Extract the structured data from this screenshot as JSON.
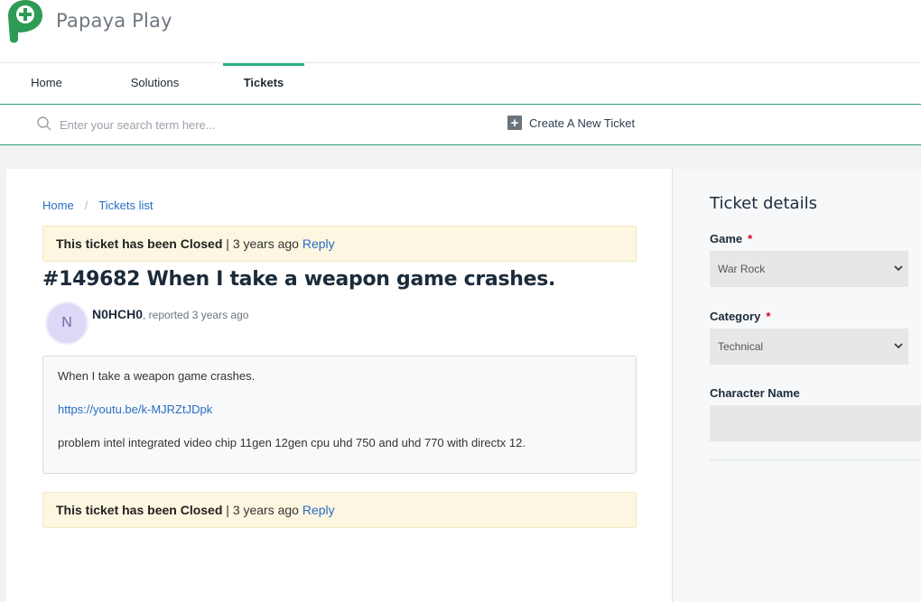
{
  "brand": {
    "name": "Papaya Play",
    "accent_color": "#2bb089",
    "logo_color": "#2e9b55",
    "logo_icon": "plus-icon"
  },
  "nav": {
    "tabs": [
      {
        "label": "Home"
      },
      {
        "label": "Solutions"
      },
      {
        "label": "Tickets",
        "active": true
      }
    ]
  },
  "search": {
    "placeholder": "Enter your search term here...",
    "icon": "search-icon"
  },
  "new_ticket": {
    "label": "Create A New Ticket",
    "icon": "plus-box-icon"
  },
  "breadcrumb": {
    "home": "Home",
    "separator": "/",
    "tickets_list": "Tickets list"
  },
  "status_notice": {
    "bold": "This ticket has been Closed",
    "separator": " | ",
    "time": "3 years ago",
    "reply": "Reply"
  },
  "ticket": {
    "title": "#149682 When I take a weapon game crashes.",
    "author": "N0HCH0",
    "avatar_letter": "N",
    "meta": ", reported 3 years ago",
    "body": {
      "line1": "When I take a weapon game crashes.",
      "link": "https://youtu.be/k-MJRZtJDpk",
      "line3": "problem intel integrated video chip 11gen 12gen cpu uhd 750 and uhd 770 with directx 12."
    }
  },
  "sidebar": {
    "title": "Ticket details",
    "game": {
      "label": "Game",
      "required": "*",
      "value": "War Rock"
    },
    "category": {
      "label": "Category",
      "required": "*",
      "value": "Technical"
    },
    "character": {
      "label": "Character Name",
      "value": ""
    }
  }
}
